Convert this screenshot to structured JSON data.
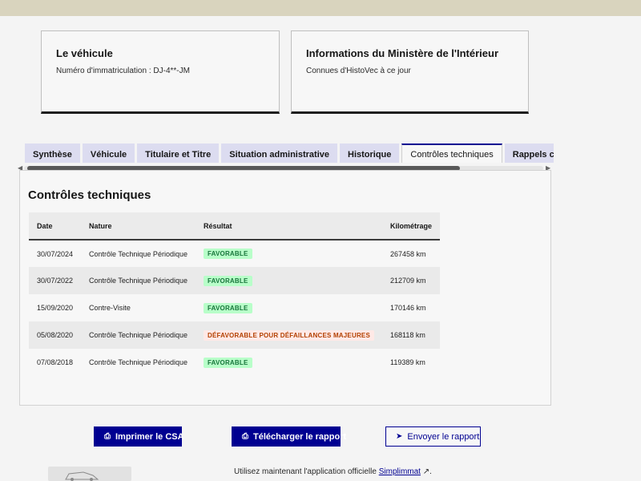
{
  "vehicle_card": {
    "title": "Le véhicule",
    "plate_text": "Numéro d'immatriculation : DJ-4**-JM"
  },
  "ministry_card": {
    "title": "Informations du Ministère de l'Intérieur",
    "subtitle": "Connues d'HistoVec à ce jour"
  },
  "tabs": [
    {
      "label": "Synthèse",
      "active": false
    },
    {
      "label": "Véhicule",
      "active": false
    },
    {
      "label": "Titulaire et Titre",
      "active": false
    },
    {
      "label": "Situation administrative",
      "active": false
    },
    {
      "label": "Historique",
      "active": false
    },
    {
      "label": "Contrôles techniques",
      "active": true
    },
    {
      "label": "Rappels constru",
      "active": false
    }
  ],
  "panel": {
    "title": "Contrôles techniques",
    "columns": [
      "Date",
      "Nature",
      "Résultat",
      "Kilométrage"
    ],
    "rows": [
      {
        "date": "30/07/2024",
        "nature": "Contrôle Technique Périodique",
        "result": "FAVORABLE",
        "status": "ok",
        "km": "267458 km"
      },
      {
        "date": "30/07/2022",
        "nature": "Contrôle Technique Périodique",
        "result": "FAVORABLE",
        "status": "ok",
        "km": "212709 km"
      },
      {
        "date": "15/09/2020",
        "nature": "Contre-Visite",
        "result": "FAVORABLE",
        "status": "ok",
        "km": "170146 km"
      },
      {
        "date": "05/08/2020",
        "nature": "Contrôle Technique Périodique",
        "result": "DÉFAVORABLE POUR DÉFAILLANCES MAJEURES",
        "status": "ko",
        "km": "168118 km"
      },
      {
        "date": "07/08/2018",
        "nature": "Contrôle Technique Périodique",
        "result": "FAVORABLE",
        "status": "ok",
        "km": "119389 km"
      }
    ]
  },
  "buttons": {
    "print": "Imprimer le CSA",
    "download": "Télécharger le rapport",
    "send": "Envoyer le rapport"
  },
  "footer": {
    "text": "Utilisez maintenant l'application officielle ",
    "link": "Simplimmat"
  },
  "icons": {
    "print": "print-icon",
    "download": "download-icon",
    "send": "send-icon",
    "external": "external-link-icon"
  },
  "colors": {
    "accent": "#000091",
    "favorable_bg": "#b8fec9",
    "favorable_text": "#18753c",
    "defavorable_bg": "#ffe9e6",
    "defavorable_text": "#b34000"
  }
}
